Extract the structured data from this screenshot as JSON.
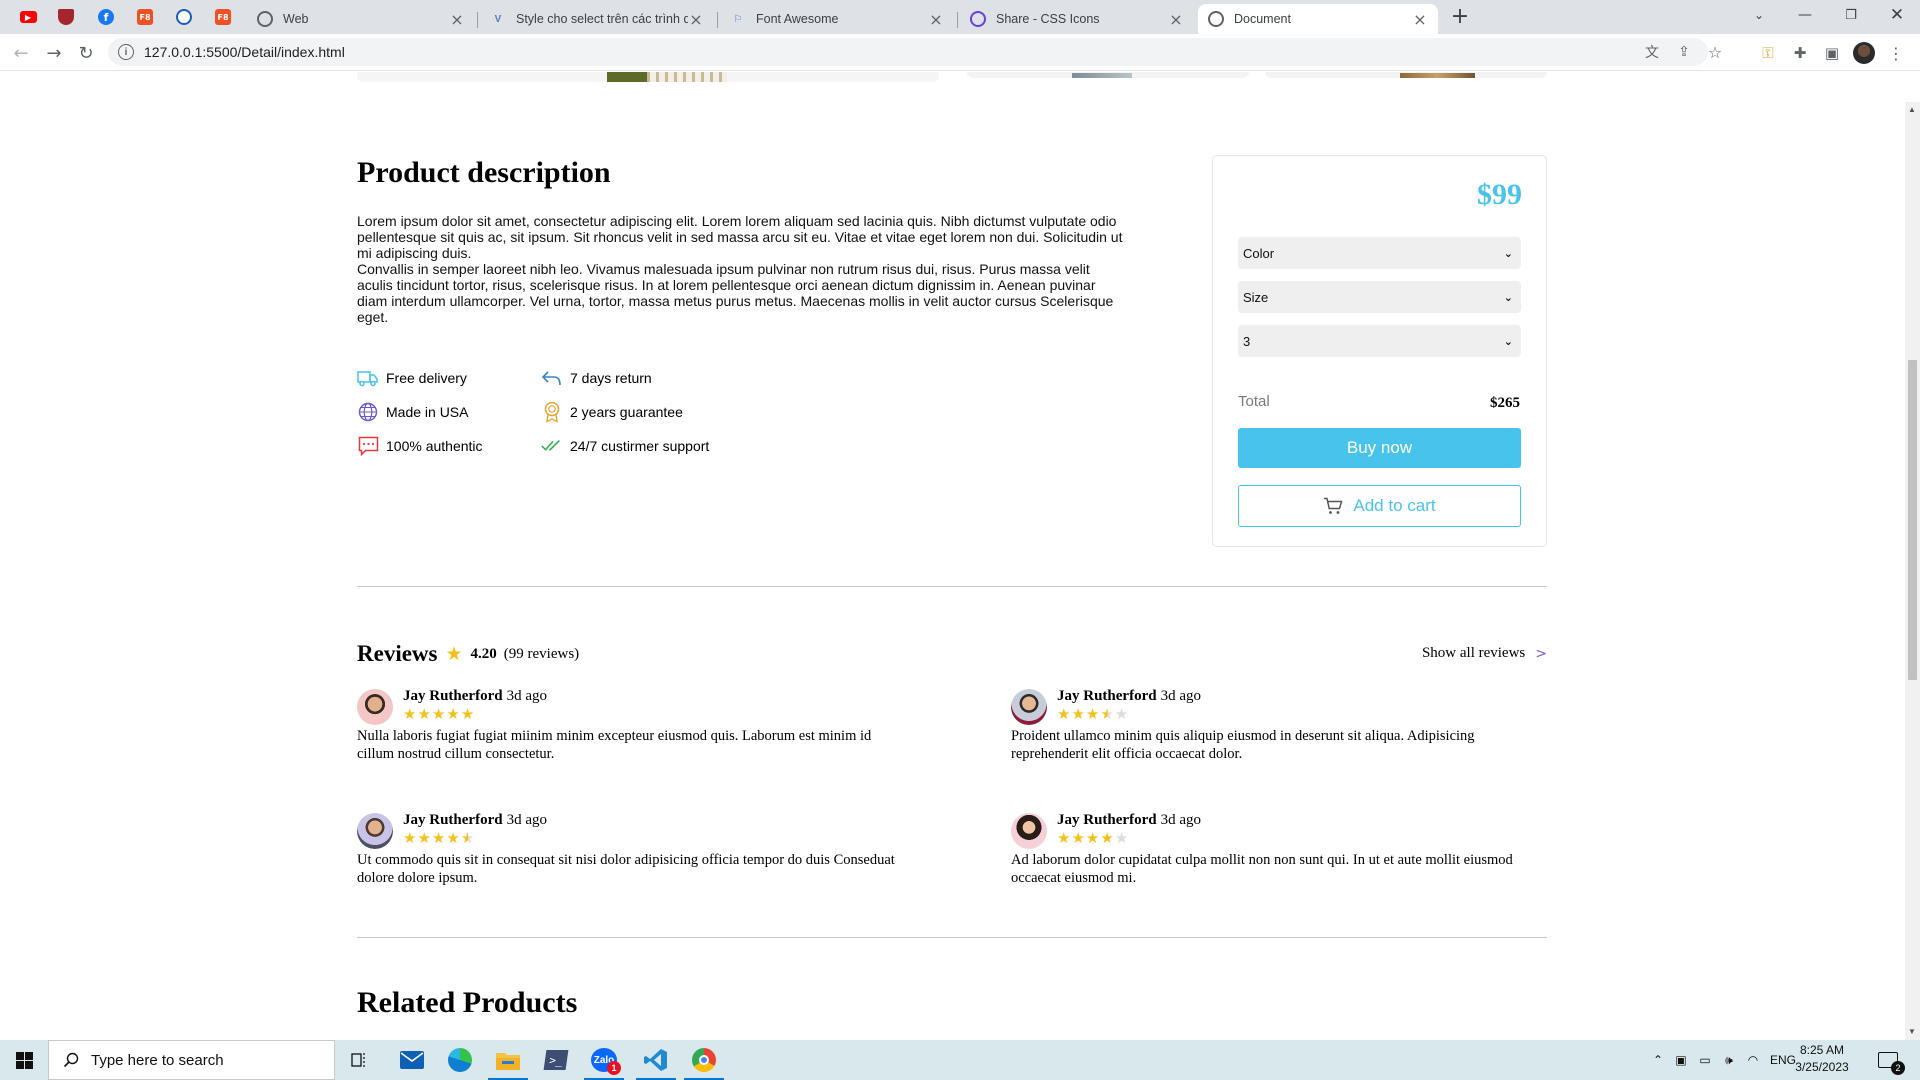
{
  "browser": {
    "tabs": [
      {
        "title": "Web"
      },
      {
        "title": "Style cho select trên các trình duyệt"
      },
      {
        "title": "Font Awesome"
      },
      {
        "title": "Share - CSS Icons"
      },
      {
        "title": "Document"
      }
    ],
    "url": "127.0.0.1:5500/Detail/index.html"
  },
  "product": {
    "description_title": "Product description",
    "description": "Lorem ipsum dolor sit amet, consectetur adipiscing elit. Lorem lorem aliquam sed lacinia quis. Nibh dictumst vulputate odio pellentesque sit quis ac, sit ipsum. Sit rhoncus velit in sed massa arcu sit eu. Vitae et vitae eget lorem non dui. Solicitudin ut mi adipiscing duis.\nConvallis in semper laoreet nibh leo. Vivamus malesuada ipsum pulvinar non rutrum risus dui, risus. Purus massa velit aculis tincidunt tortor, risus, scelerisque risus. In at lorem pellentesque orci aenean dictum dignissim in. Aenean puvinar diam interdum ullamcorper. Vel urna, tortor, massa metus purus metus. Maecenas mollis in velit auctor cursus Scelerisque eget.",
    "features": [
      {
        "label": "Free delivery",
        "icon": "truck-icon"
      },
      {
        "label": "7 days return",
        "icon": "return-arrow-icon"
      },
      {
        "label": "Made in USA",
        "icon": "globe-icon"
      },
      {
        "label": "2 years guarantee",
        "icon": "medal-icon"
      },
      {
        "label": "100% authentic",
        "icon": "chat-dots-icon"
      },
      {
        "label": "24/7 custirmer support",
        "icon": "double-check-icon"
      }
    ]
  },
  "order": {
    "price": "$99",
    "color_select": "Color",
    "size_select": "Size",
    "quantity_select": "3",
    "total_label": "Total",
    "total_value": "$265",
    "buy_label": "Buy now",
    "cart_label": "Add to cart",
    "accent_color": "#48c3ec"
  },
  "reviews": {
    "title": "Reviews",
    "score": "4.20",
    "count": "(99 reviews)",
    "show_all": "Show all reviews",
    "show_all_arrow": ">",
    "items": [
      {
        "name": "Jay Rutherford",
        "ago": "3d ago",
        "rating": 5,
        "text": "Nulla laboris fugiat fugiat miinim minim excepteur eiusmod quis. Laborum est minim id cillum nostrud cillum consectetur."
      },
      {
        "name": "Jay Rutherford",
        "ago": "3d ago",
        "rating": 3.5,
        "text": "Proident ullamco minim quis aliquip eiusmod in deserunt sit aliqua. Adipisicing reprehenderit elit officia occaecat dolor."
      },
      {
        "name": "Jay Rutherford",
        "ago": "3d ago",
        "rating": 4.5,
        "text": "Ut commodo quis sit in consequat sit nisi dolor adipisicing officia tempor do duis Conseduat dolore dolore ipsum."
      },
      {
        "name": "Jay Rutherford",
        "ago": "3d ago",
        "rating": 4,
        "text": "Ad laborum dolor cupidatat culpa mollit non non sunt qui. In ut et aute mollit eiusmod occaecat eiusmod mi."
      }
    ],
    "star_color": "#f3c11b"
  },
  "related_title": "Related Products",
  "taskbar": {
    "search_placeholder": "Type here to search",
    "language": "ENG",
    "time": "8:25 AM",
    "date": "3/25/2023",
    "notification_count": "2",
    "badge_count": "1"
  }
}
